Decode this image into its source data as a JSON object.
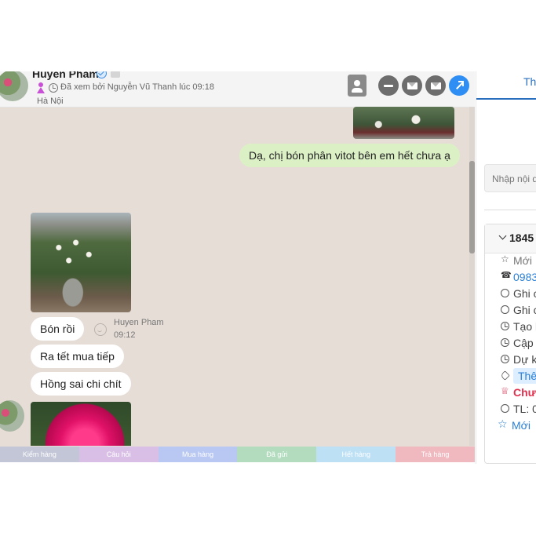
{
  "chat": {
    "header": {
      "name": "Huyen Pham",
      "seen_text": "Đã xem bởi Nguyễn Vũ Thanh lúc 09:18",
      "location": "Hà Nội"
    },
    "messages": [
      {
        "type": "image",
        "direction": "out",
        "subject": "garden-pot"
      },
      {
        "type": "text",
        "direction": "out",
        "text": "Dạ, chị bón phân vitot bên em hết chưa ạ"
      },
      {
        "type": "image",
        "direction": "in",
        "subject": "rose-garden"
      },
      {
        "type": "text",
        "direction": "in",
        "text": "Bón rồi"
      },
      {
        "type": "text",
        "direction": "in",
        "text": "Ra tết mua tiếp"
      },
      {
        "type": "text",
        "direction": "in",
        "text": "Hồng sai chi chít"
      },
      {
        "type": "image",
        "direction": "in",
        "subject": "pink-rose"
      }
    ],
    "sender": {
      "name": "Huyen Pham",
      "time": "09:12"
    },
    "label_bar": [
      {
        "label": "Kiểm hàng",
        "color": "#c3c6d6"
      },
      {
        "label": "Câu hỏi",
        "color": "#d9bfe6"
      },
      {
        "label": "Mua hàng",
        "color": "#b9c8f3"
      },
      {
        "label": "Đã gửi",
        "color": "#b3dcbf"
      },
      {
        "label": "Hết hàng",
        "color": "#bde0f5"
      },
      {
        "label": "Trả hàng",
        "color": "#f0b9bf"
      }
    ]
  },
  "right_panel": {
    "tab_label": "Th",
    "note_placeholder": "Nhập nội d",
    "card": {
      "title": "1845",
      "rows": [
        {
          "icon": "star-outline-icon",
          "text": "Mới"
        },
        {
          "icon": "phone-icon",
          "text": "0983"
        },
        {
          "icon": "comment-icon",
          "text": "Ghi c"
        },
        {
          "icon": "comment-icon",
          "text": "Ghi c"
        },
        {
          "icon": "clock-icon",
          "text": "Tạo l"
        },
        {
          "icon": "clock-icon",
          "text": "Cập n"
        },
        {
          "icon": "clock-icon",
          "text": "Dự k"
        },
        {
          "icon": "tag-icon",
          "text": "Thê"
        },
        {
          "icon": "shirt-icon",
          "text": "Chưa"
        },
        {
          "icon": "gauge-icon",
          "text": "TL: 0"
        }
      ],
      "new_link": "Mới"
    }
  }
}
